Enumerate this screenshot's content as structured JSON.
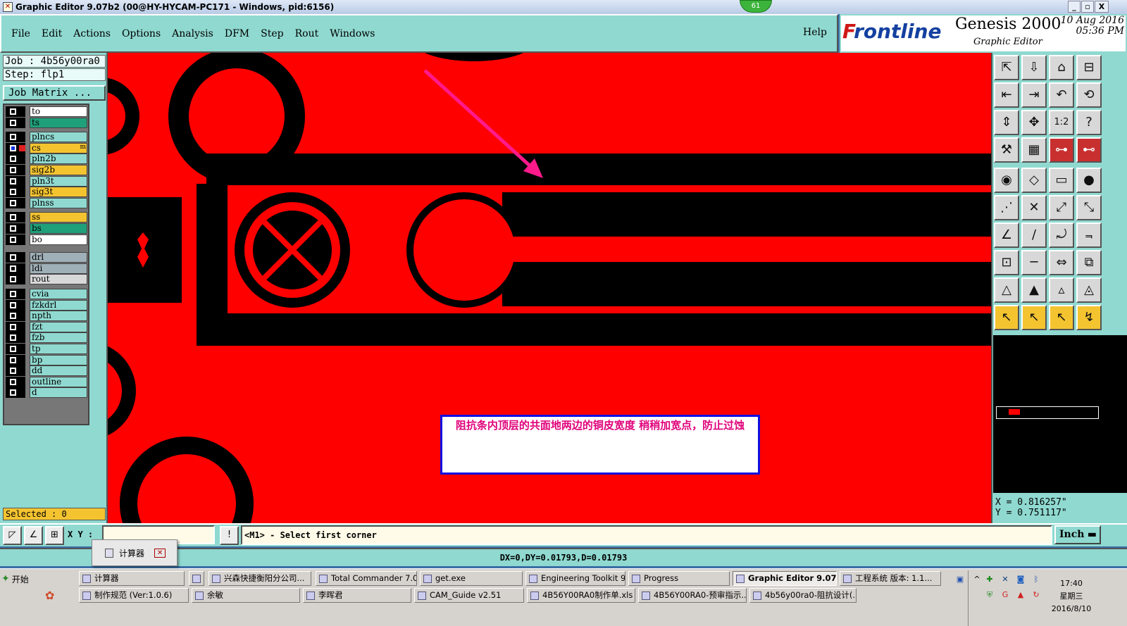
{
  "window": {
    "title": "Graphic Editor 9.07b2 (00@HY-HYCAM-PC171 - Windows, pid:6156)",
    "badge": "61",
    "controls": {
      "minimize": "_",
      "restore": "▫",
      "close": "X"
    }
  },
  "menu": {
    "items": [
      "File",
      "Edit",
      "Actions",
      "Options",
      "Analysis",
      "DFM",
      "Step",
      "Rout",
      "Windows"
    ],
    "help": "Help"
  },
  "logo": {
    "brand_prefix": "F",
    "brand_rest": "rontline",
    "product": "Genesis 2000",
    "subtitle": "Graphic Editor",
    "date": "10 Aug 2016",
    "time": "05:36 PM",
    "colors": {
      "brand_blue": "#1440a0",
      "brand_red": "#d01818"
    }
  },
  "job": {
    "job_label": "Job : 4b56y00ra0",
    "step_label": "Step: flp1",
    "matrix_button": "Job Matrix ..."
  },
  "layers": [
    {
      "name": "to",
      "color": "#ffffff",
      "active": false
    },
    {
      "name": "ts",
      "color": "#1fa07a",
      "active": false
    },
    {
      "name": "plncs",
      "color": "#8fd9d0",
      "active": false
    },
    {
      "name": "cs",
      "color": "#f4c430",
      "active": true,
      "marker": "m"
    },
    {
      "name": "pln2b",
      "color": "#8fd9d0",
      "active": false
    },
    {
      "name": "sig2b",
      "color": "#f4c430",
      "active": false
    },
    {
      "name": "pln3t",
      "color": "#8fd9d0",
      "active": false
    },
    {
      "name": "sig3t",
      "color": "#f4c430",
      "active": false
    },
    {
      "name": "plnss",
      "color": "#8fd9d0",
      "active": false
    },
    {
      "name": "ss",
      "color": "#f4c430",
      "active": false
    },
    {
      "name": "bs",
      "color": "#1fa07a",
      "active": false
    },
    {
      "name": "bo",
      "color": "#ffffff",
      "active": false
    },
    {
      "name": "drl",
      "color": "#a0b0b8",
      "active": false
    },
    {
      "name": "ldi",
      "color": "#a0b0b8",
      "active": false
    },
    {
      "name": "rout",
      "color": "#d8d8d8",
      "active": false
    },
    {
      "name": "cvia",
      "color": "#8fd9d0",
      "active": false
    },
    {
      "name": "fzkdrl",
      "color": "#8fd9d0",
      "active": false
    },
    {
      "name": "npth",
      "color": "#8fd9d0",
      "active": false
    },
    {
      "name": "fzt",
      "color": "#8fd9d0",
      "active": false
    },
    {
      "name": "fzb",
      "color": "#8fd9d0",
      "active": false
    },
    {
      "name": "tp",
      "color": "#8fd9d0",
      "active": false
    },
    {
      "name": "bp",
      "color": "#8fd9d0",
      "active": false
    },
    {
      "name": "dd",
      "color": "#8fd9d0",
      "active": false
    },
    {
      "name": "outline",
      "color": "#8fd9d0",
      "active": false
    },
    {
      "name": "d",
      "color": "#8fd9d0",
      "active": false
    }
  ],
  "selected": "Selected : 0",
  "annotation": "阻抗条内顶层的共面地两边的铜皮宽度  稍稍加宽点，防止过蚀",
  "coords": {
    "x": "X = 0.816257\"",
    "y": "Y = 0.751117\""
  },
  "command": {
    "xy_label": "X Y :",
    "xy_value": "",
    "info_icon": "!",
    "prompt": "<M1> - Select first corner",
    "units": "Inch"
  },
  "status": "DX=0,DY=0.01793,D=0.01793",
  "calc_popup": {
    "label": "计算器"
  },
  "taskbar": {
    "start": "开始",
    "row1": [
      {
        "label": "计算器",
        "active": false
      },
      {
        "label": "",
        "active": false
      },
      {
        "label": "兴森快捷衡阳分公司...",
        "active": false
      },
      {
        "label": "Total Commander 7.0 ...",
        "active": false
      },
      {
        "label": "get.exe",
        "active": false
      },
      {
        "label": "Engineering Toolkit 9.0...",
        "active": false
      },
      {
        "label": "Progress",
        "active": false
      },
      {
        "label": "Graphic Editor 9.07b...",
        "active": true
      },
      {
        "label": "工程系统  版本: 1.1...",
        "active": false
      }
    ],
    "row2": [
      {
        "label": "制作规范 (Ver:1.0.6)",
        "active": false
      },
      {
        "label": "余敏",
        "active": false
      },
      {
        "label": "李晖君",
        "active": false
      },
      {
        "label": "CAM_Guide v2.51",
        "active": false
      },
      {
        "label": "4B56Y00RA0制作单.xls ...",
        "active": false
      },
      {
        "label": "4B56Y00RA0-预审指示....",
        "active": false
      },
      {
        "label": "4b56y00ra0-阻抗设计(...",
        "active": false
      }
    ],
    "clock": {
      "time": "17:40",
      "day": "星期三",
      "date": "2016/8/10"
    }
  },
  "toolbar_icons": [
    "zoom-home-icon",
    "pan-up-icon",
    "home-view-icon",
    "fit-window-icon",
    "pan-left-icon",
    "pan-right-icon",
    "undo-view-icon",
    "redraw-icon",
    "fit-all-icon",
    "center-icon",
    "scale-1to2-icon",
    "help-icon",
    "drill-tool-icon",
    "grid-icon",
    "net-highlight-icon",
    "net-select-icon",
    "measure-pad-icon",
    "measure-angle-icon",
    "ruler-icon",
    "select-pad-icon",
    "snap-node-icon",
    "snap-cross-icon",
    "snap-point-icon",
    "snap-line-icon",
    "line-angle-icon",
    "line-draw-icon",
    "arc-icon",
    "flip-icon",
    "point-to-point-icon",
    "midpoint-icon",
    "distance-icon",
    "feature-select-icon",
    "triangle-small-icon",
    "triangle-med-icon",
    "triangle-large-icon",
    "triangle-outline-icon",
    "pointer-icon",
    "pointer-box-icon",
    "pointer-net-icon",
    "pointer-route-icon"
  ]
}
